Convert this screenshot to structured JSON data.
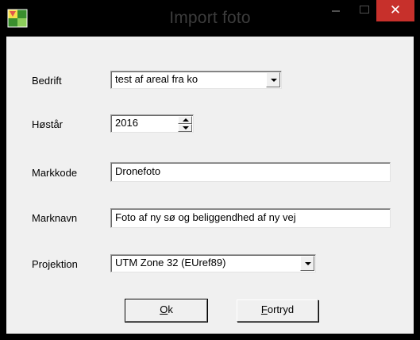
{
  "window": {
    "title": "Import foto",
    "icon": "map-photo-icon",
    "controls": {
      "minimize": "minimize-icon",
      "maximize": "maximize-icon",
      "close": "✕"
    },
    "colors": {
      "frame": "#000000",
      "client": "#f0f0f0",
      "close": "#c7302b"
    }
  },
  "form": {
    "bedrift": {
      "label": "Bedrift",
      "value": "test af areal fra ko"
    },
    "hostar": {
      "label": "Høstår",
      "value": "2016"
    },
    "markkode": {
      "label": "Markkode",
      "value": "Dronefoto"
    },
    "marknavn": {
      "label": "Marknavn",
      "value": "Foto af ny sø og beliggendhed af ny vej"
    },
    "projektion": {
      "label": "Projektion",
      "value": "UTM Zone 32 (EUref89)"
    }
  },
  "buttons": {
    "ok": {
      "mnemonic": "O",
      "rest": "k"
    },
    "cancel": {
      "mnemonic": "F",
      "rest": "ortryd"
    }
  }
}
